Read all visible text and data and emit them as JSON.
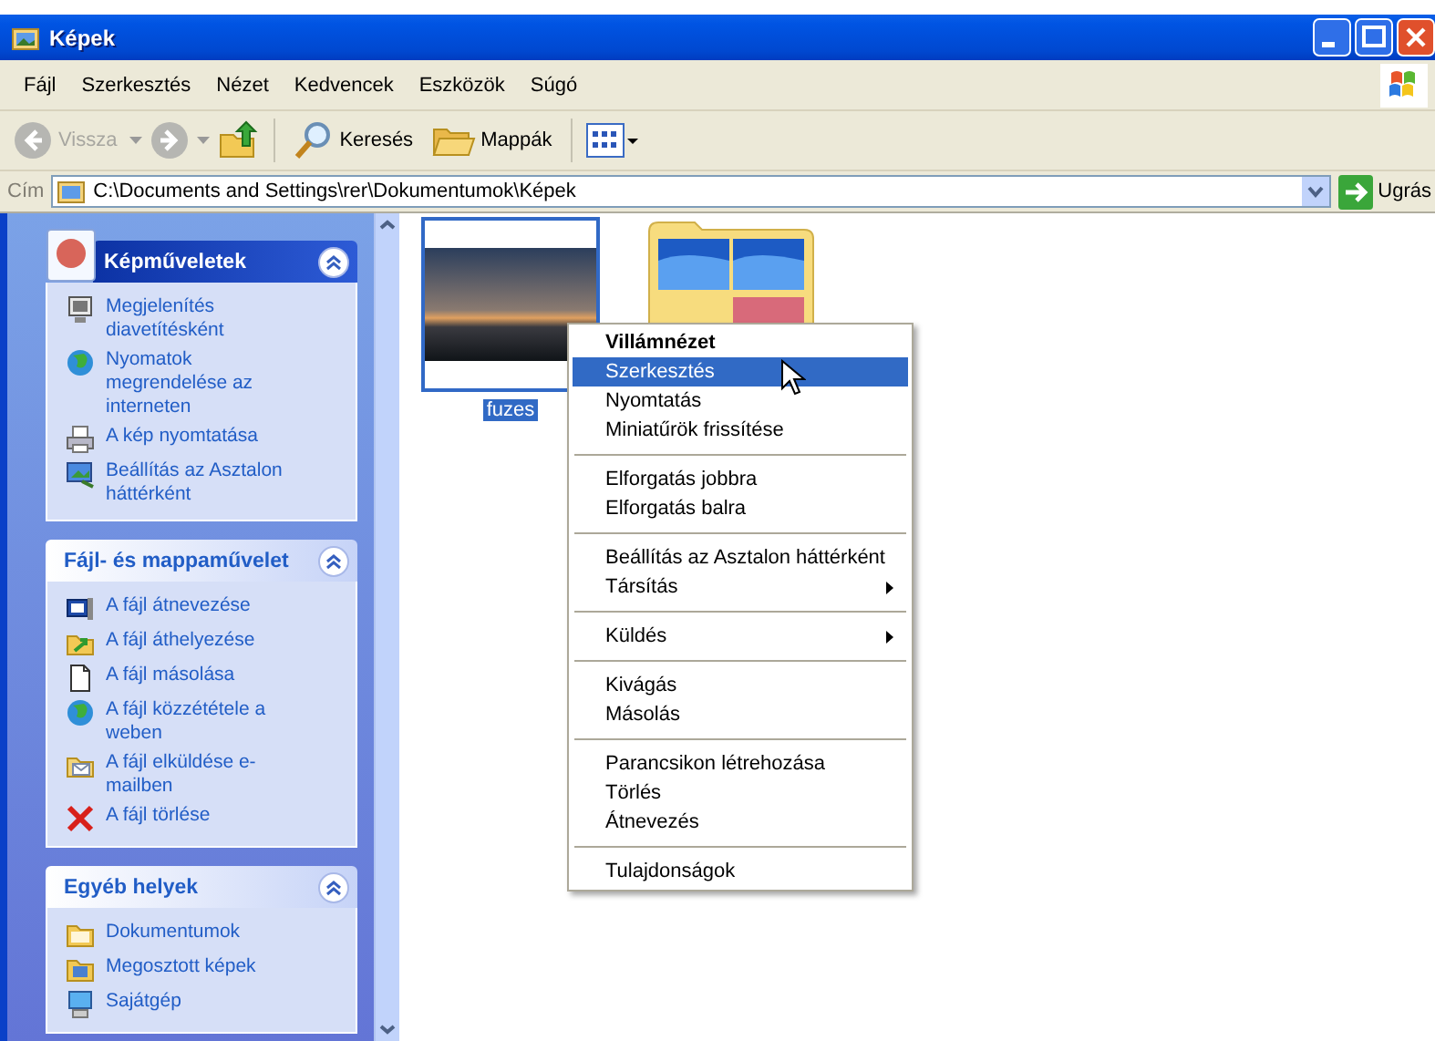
{
  "window": {
    "title": "Képek"
  },
  "menu_bar": [
    "Fájl",
    "Szerkesztés",
    "Nézet",
    "Kedvencek",
    "Eszközök",
    "Súgó"
  ],
  "toolbar": {
    "back_label": "Vissza",
    "search_label": "Keresés",
    "folders_label": "Mappák"
  },
  "address_bar": {
    "label": "Cím",
    "path": "C:\\Documents and Settings\\rer\\Dokumentumok\\Képek",
    "go_label": "Ugrás"
  },
  "task_panels": [
    {
      "title": "Képműveletek",
      "kind": "special",
      "expanded": true,
      "items": [
        {
          "label": "Megjelenítés diavetítésként"
        },
        {
          "label": "Nyomatok megrendelése az interneten"
        },
        {
          "label": "A kép nyomtatása"
        },
        {
          "label": "Beállítás az Asztalon háttérként"
        }
      ]
    },
    {
      "title": "Fájl- és mappaművelet",
      "kind": "normal",
      "expanded": true,
      "items": [
        {
          "label": "A fájl átnevezése"
        },
        {
          "label": "A fájl áthelyezése"
        },
        {
          "label": "A fájl másolása"
        },
        {
          "label": "A fájl közzététele a weben"
        },
        {
          "label": "A fájl elküldése e-mailben"
        },
        {
          "label": "A fájl törlése"
        }
      ]
    },
    {
      "title": "Egyéb helyek",
      "kind": "normal",
      "expanded": true,
      "items": [
        {
          "label": "Dokumentumok"
        },
        {
          "label": "Megosztott képek"
        },
        {
          "label": "Sajátgép"
        }
      ]
    }
  ],
  "files": [
    {
      "kind": "photo",
      "name": "fuzes",
      "selected": true
    },
    {
      "kind": "folder",
      "selected": false
    }
  ],
  "context_menu": [
    {
      "kind": "item",
      "label": "Villámnézet",
      "default": true,
      "selected": false,
      "submenu": false
    },
    {
      "kind": "item",
      "label": "Szerkesztés",
      "default": false,
      "selected": true,
      "submenu": false
    },
    {
      "kind": "item",
      "label": "Nyomtatás",
      "default": false,
      "selected": false,
      "submenu": false
    },
    {
      "kind": "item",
      "label": "Miniatűrök frissítése",
      "default": false,
      "selected": false,
      "submenu": false
    },
    {
      "kind": "separator"
    },
    {
      "kind": "item",
      "label": "Elforgatás jobbra",
      "default": false,
      "selected": false,
      "submenu": false
    },
    {
      "kind": "item",
      "label": "Elforgatás balra",
      "default": false,
      "selected": false,
      "submenu": false
    },
    {
      "kind": "separator"
    },
    {
      "kind": "item",
      "label": "Beállítás az Asztalon háttérként",
      "default": false,
      "selected": false,
      "submenu": false
    },
    {
      "kind": "item",
      "label": "Társítás",
      "default": false,
      "selected": false,
      "submenu": true
    },
    {
      "kind": "separator"
    },
    {
      "kind": "item",
      "label": "Küldés",
      "default": false,
      "selected": false,
      "submenu": true
    },
    {
      "kind": "separator"
    },
    {
      "kind": "item",
      "label": "Kivágás",
      "default": false,
      "selected": false,
      "submenu": false
    },
    {
      "kind": "item",
      "label": "Másolás",
      "default": false,
      "selected": false,
      "submenu": false
    },
    {
      "kind": "separator"
    },
    {
      "kind": "item",
      "label": "Parancsikon létrehozása",
      "default": false,
      "selected": false,
      "submenu": false
    },
    {
      "kind": "item",
      "label": "Törlés",
      "default": false,
      "selected": false,
      "submenu": false
    },
    {
      "kind": "item",
      "label": "Átnevezés",
      "default": false,
      "selected": false,
      "submenu": false
    },
    {
      "kind": "separator"
    },
    {
      "kind": "item",
      "label": "Tulajdonságok",
      "default": false,
      "selected": false,
      "submenu": false
    }
  ]
}
